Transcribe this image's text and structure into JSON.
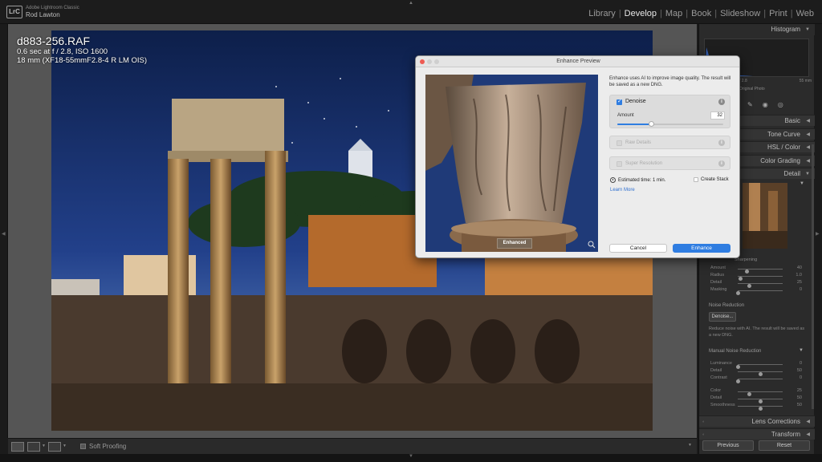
{
  "app": {
    "name": "Adobe Lightroom Classic",
    "user": "Rod Lawton",
    "logo": "LrC"
  },
  "modules": [
    "Library",
    "Develop",
    "Map",
    "Book",
    "Slideshow",
    "Print",
    "Web"
  ],
  "active_module": "Develop",
  "photo": {
    "filename": "d883-256.RAF",
    "exposure": "0.6 sec at f / 2.8, ISO 1600",
    "lens": "18 mm (XF18-55mmF2.8-4 R LM OIS)"
  },
  "toolbar": {
    "soft_proofing": "Soft Proofing"
  },
  "panel": {
    "histogram": "Histogram",
    "hist_meta": [
      "/ 2.8",
      "55 mm"
    ],
    "original_photo": "Original Photo",
    "sections": {
      "basic": "Basic",
      "tone_curve": "Tone Curve",
      "hsl": "HSL / Color",
      "color_grading": "Color Grading",
      "detail": "Detail",
      "lens_corrections": "Lens Corrections",
      "transform": "Transform"
    },
    "sharpening_title": "Sharpening",
    "sharpen_sliders": [
      {
        "label": "Amount",
        "value": "40",
        "pos": 0.2
      },
      {
        "label": "Radius",
        "value": "1.0",
        "pos": 0.05
      },
      {
        "label": "Detail",
        "value": "25",
        "pos": 0.25
      },
      {
        "label": "Masking",
        "value": "0",
        "pos": 0.0
      }
    ],
    "noise_reduction_title": "Noise Reduction",
    "denoise_button": "Denoise...",
    "nr_desc": "Reduce noise with AI. The result will be saved as a new DNG.",
    "manual_nr_title": "Manual Noise Reduction",
    "lum_sliders": [
      {
        "label": "Luminance",
        "value": "0",
        "pos": 0.0
      },
      {
        "label": "Detail",
        "value": "50",
        "pos": 0.5
      },
      {
        "label": "Contrast",
        "value": "0",
        "pos": 0.0
      }
    ],
    "color_sliders": [
      {
        "label": "Color",
        "value": "25",
        "pos": 0.25
      },
      {
        "label": "Detail",
        "value": "50",
        "pos": 0.5
      },
      {
        "label": "Smoothness",
        "value": "50",
        "pos": 0.5
      }
    ],
    "previous": "Previous",
    "reset": "Reset"
  },
  "dialog": {
    "title": "Enhance Preview",
    "preview_label": "Enhanced",
    "description": "Enhance uses AI to improve image quality. The result will be saved as a new DNG.",
    "denoise": {
      "label": "Denoise",
      "checked": true,
      "amount_label": "Amount",
      "amount": "32",
      "amount_fraction": 0.32
    },
    "raw_details": "Raw Details",
    "super_resolution": "Super Resolution",
    "estimated_time": "Estimated time: 1 min.",
    "create_stack": "Create Stack",
    "learn_more": "Learn More",
    "cancel": "Cancel",
    "enhance": "Enhance"
  },
  "colors": {
    "accent": "#2f7de1",
    "dialog_bg": "#ececec",
    "panel_bg": "#2b2b2b",
    "canvas_bg": "#555555"
  }
}
